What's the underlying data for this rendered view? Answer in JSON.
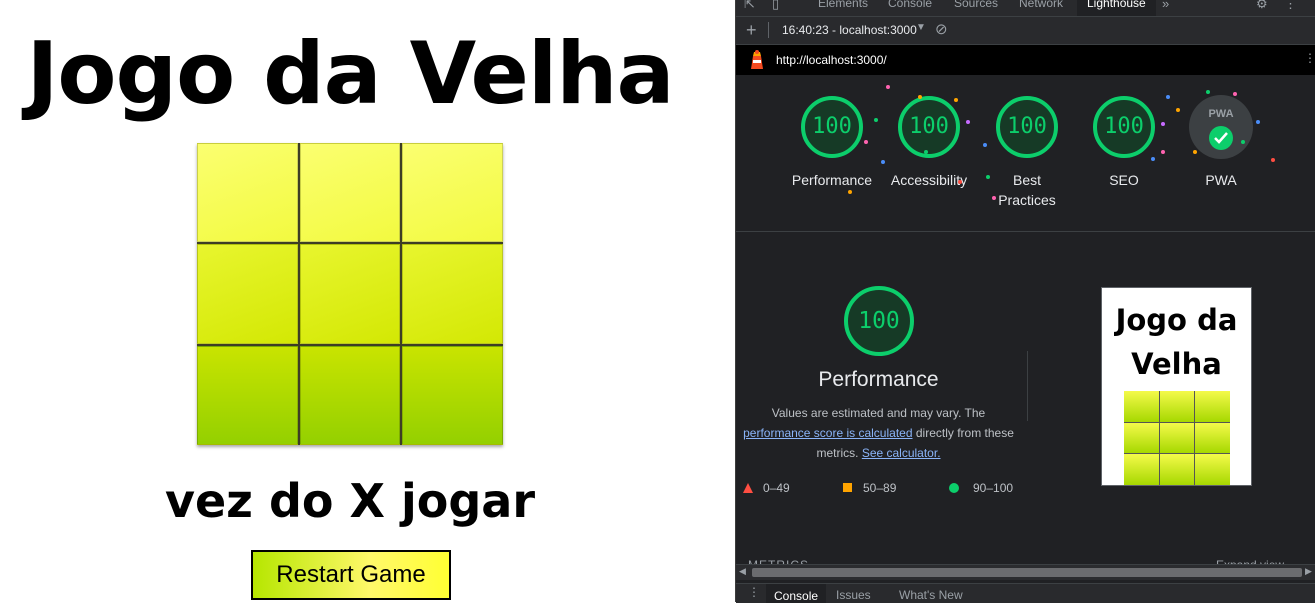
{
  "game": {
    "title": "Jogo da Velha",
    "turn_text": "vez do X jogar",
    "restart_label": "Restart Game",
    "cells": [
      "",
      "",
      "",
      "",
      "",
      "",
      "",
      "",
      ""
    ]
  },
  "devtools": {
    "tabs": [
      "Elements",
      "Console",
      "Sources",
      "Network",
      "Lighthouse"
    ],
    "active_tab": "Lighthouse",
    "more_tabs_icon": "»",
    "report_selector": "16:40:23 - localhost:3000",
    "report_url": "http://localhost:3000/",
    "categories": [
      {
        "label": "Performance",
        "score": "100"
      },
      {
        "label": "Accessibility",
        "score": "100"
      },
      {
        "label": "Best Practices",
        "score": "100"
      },
      {
        "label": "SEO",
        "score": "100"
      },
      {
        "label": "PWA",
        "score": "PWA"
      }
    ],
    "performance": {
      "score": "100",
      "title": "Performance",
      "desc_1": "Values are estimated and may vary. The",
      "desc_link_1": "performance score is calculated",
      "desc_2": "directly from these",
      "desc_3": "metrics.",
      "desc_link_2": "See calculator."
    },
    "legend": [
      {
        "range": "0–49",
        "color": "#ff4e42"
      },
      {
        "range": "50–89",
        "color": "#ffa400"
      },
      {
        "range": "90–100",
        "color": "#0cce6b"
      }
    ],
    "thumbnail_title": "Jogo da Velha",
    "metrics_label": "METRICS",
    "expand_view_label": "Expand view",
    "drawer_tabs": [
      "Console",
      "Issues",
      "What's New"
    ],
    "pass_color": "#0cce6b"
  }
}
